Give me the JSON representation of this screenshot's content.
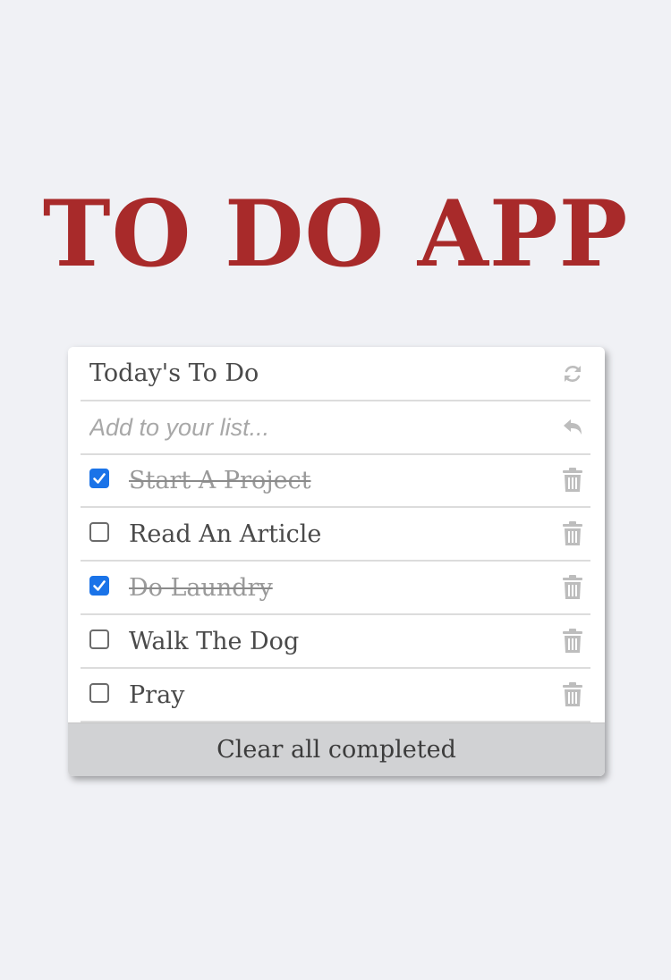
{
  "app": {
    "title": "TO DO APP"
  },
  "list": {
    "header_title": "Today's To Do",
    "input_placeholder": "Add to your list...",
    "input_value": "",
    "refresh_icon": "refresh-icon",
    "enter_icon": "enter-icon",
    "items": [
      {
        "label": "Start A Project",
        "completed": true
      },
      {
        "label": "Read An Article",
        "completed": false
      },
      {
        "label": "Do Laundry",
        "completed": true
      },
      {
        "label": "Walk The Dog",
        "completed": false
      },
      {
        "label": "Pray",
        "completed": false
      }
    ],
    "clear_button_label": "Clear all completed"
  },
  "colors": {
    "page_background": "#f0f1f5",
    "title_red": "#a82a2a",
    "checkbox_blue": "#1a73e8",
    "icon_gray": "#bdbdbd",
    "footer_gray": "#d1d2d4"
  }
}
